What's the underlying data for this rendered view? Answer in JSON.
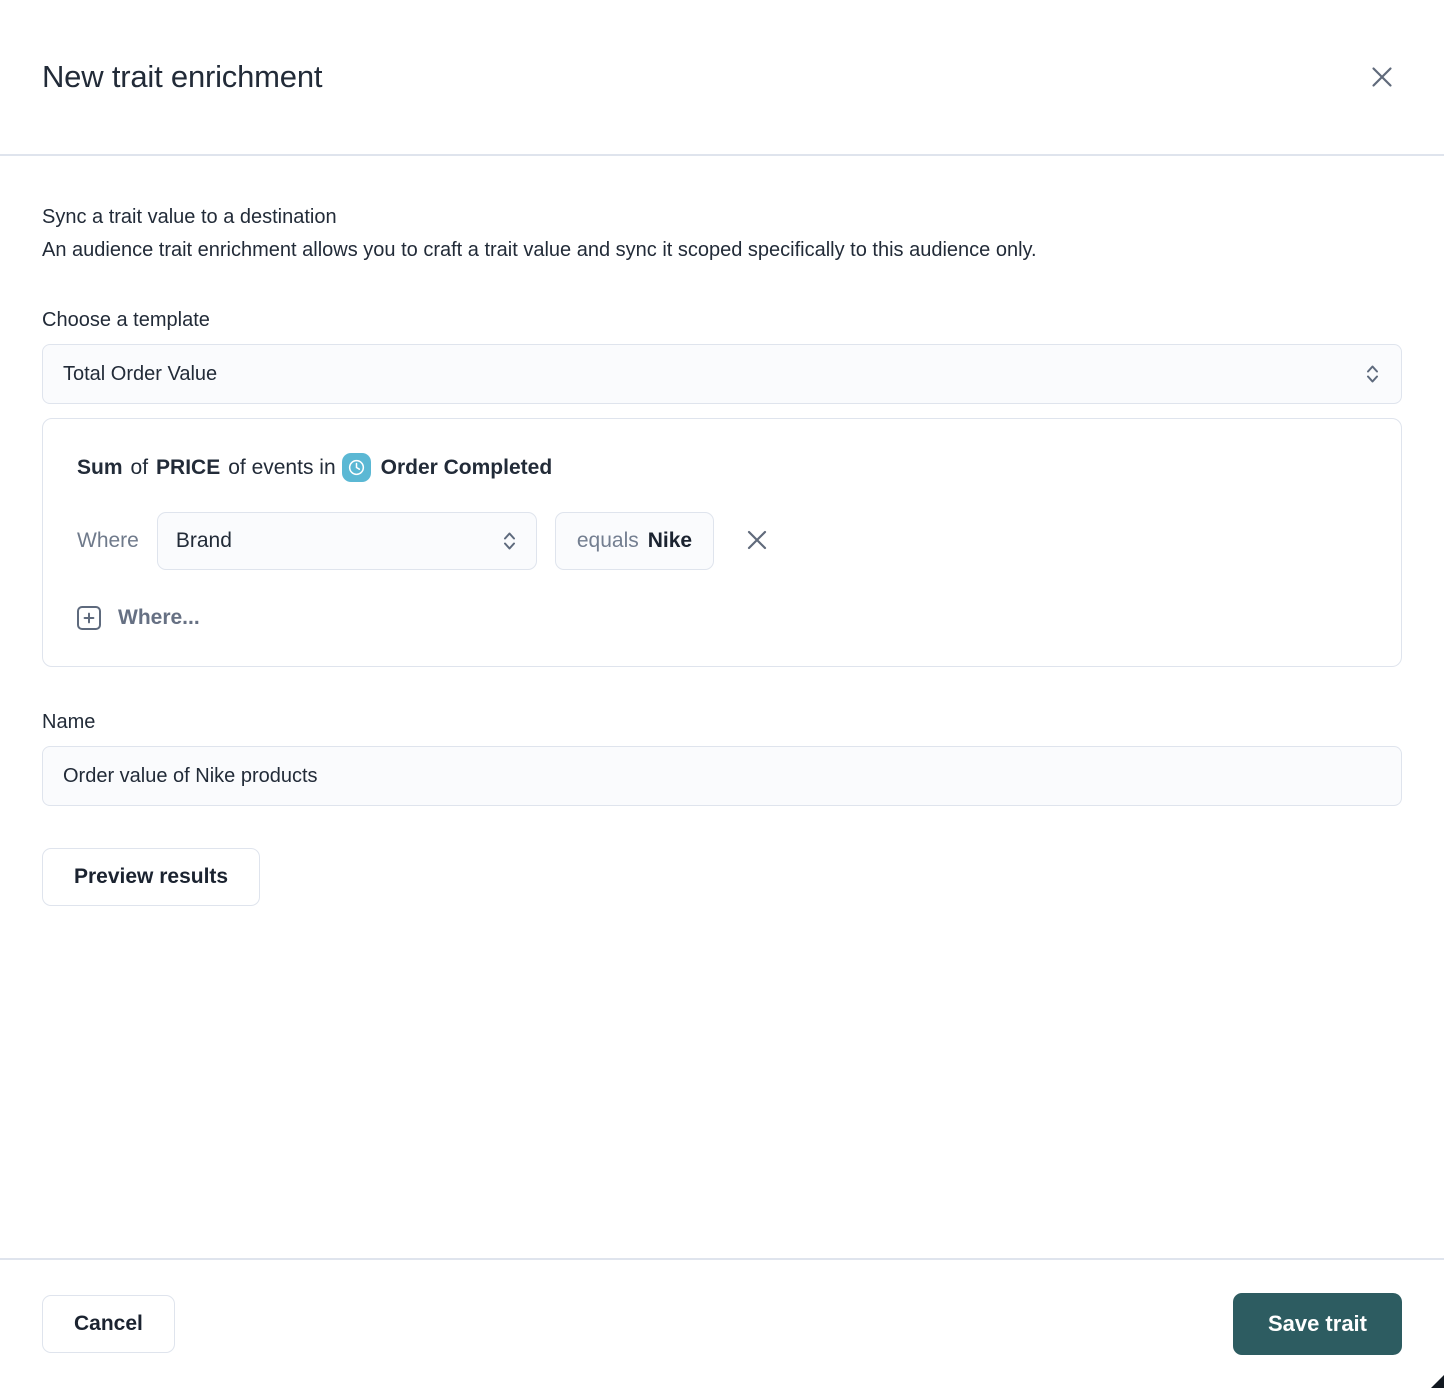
{
  "header": {
    "title": "New trait enrichment",
    "close_icon": "close-icon"
  },
  "intro": {
    "heading": "Sync a trait value to a destination",
    "description": "An audience trait enrichment allows you to craft a trait value and sync it scoped specifically to this audience only."
  },
  "template": {
    "label": "Choose a template",
    "selected": "Total Order Value",
    "stepper_icon": "chevron-up-down-icon"
  },
  "formula": {
    "aggregation": "Sum",
    "of_1": "of",
    "property": "PRICE",
    "of_events_in": "of events in",
    "event_icon": "clock-icon",
    "event_name": "Order Completed",
    "condition": {
      "where_label": "Where",
      "property": "Brand",
      "property_stepper_icon": "chevron-up-down-icon",
      "operator": "equals",
      "value": "Nike",
      "remove_icon": "close-icon"
    },
    "add_condition": {
      "icon": "plus-square-icon",
      "label": "Where..."
    }
  },
  "name": {
    "label": "Name",
    "value": "Order value of Nike products"
  },
  "actions": {
    "preview": "Preview results",
    "cancel": "Cancel",
    "save": "Save trait"
  },
  "colors": {
    "primary": "#2d5c61",
    "event_badge": "#5bb8d4",
    "border": "#dfe4ed",
    "text": "#222b38",
    "muted_text": "#6f7a8b"
  }
}
